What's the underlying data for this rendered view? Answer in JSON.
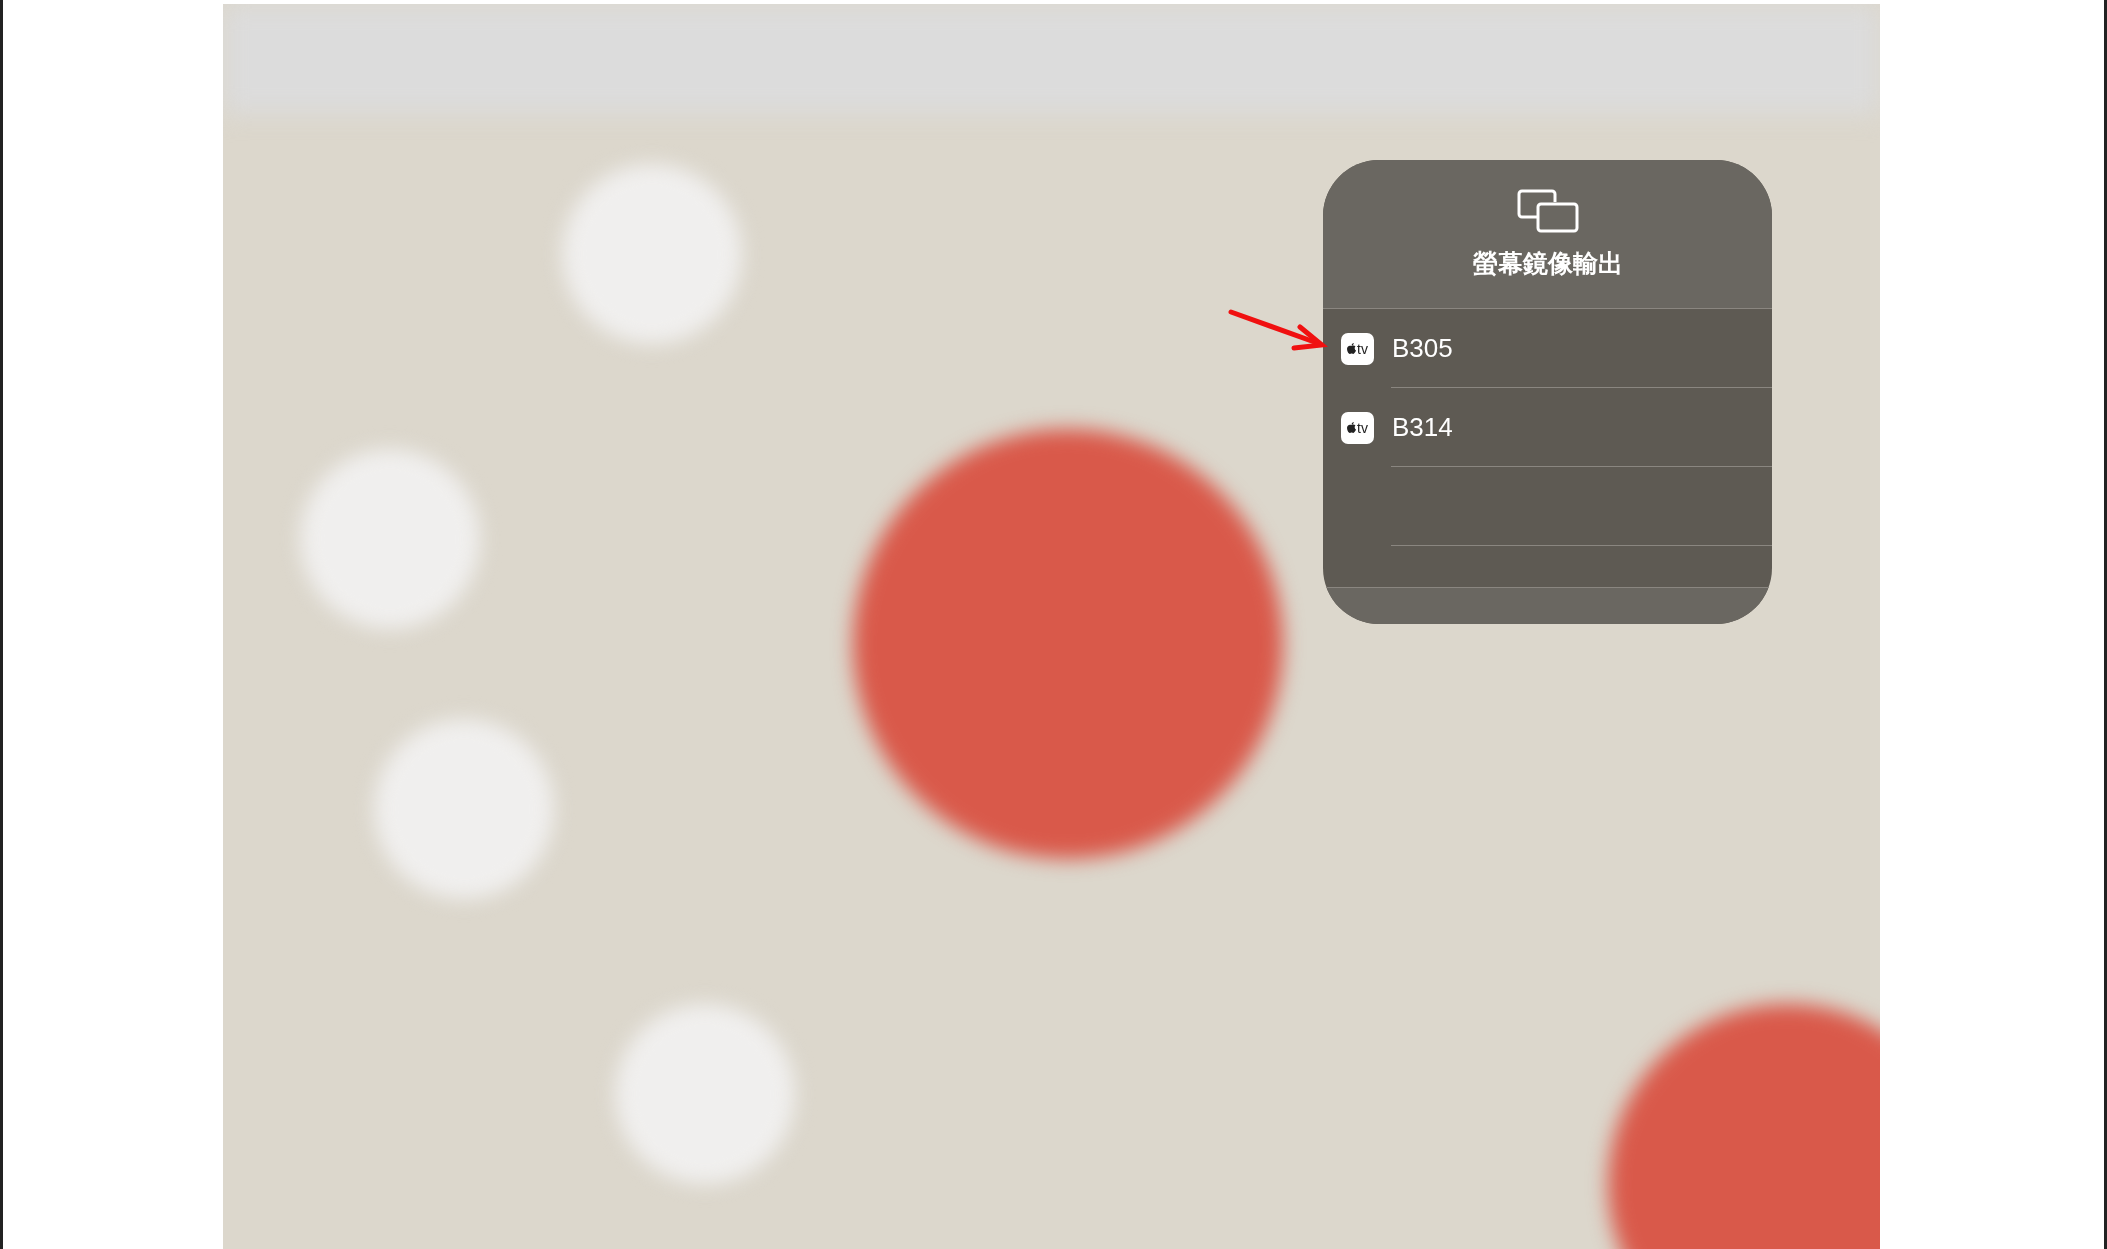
{
  "popup": {
    "title": "螢幕鏡像輸出",
    "devices": [
      {
        "name": "B305",
        "badge": "tv"
      },
      {
        "name": "B314",
        "badge": "tv"
      }
    ]
  }
}
